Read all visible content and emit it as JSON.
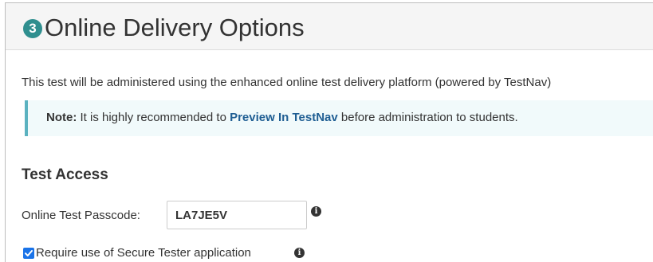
{
  "section": {
    "step_number": "3",
    "title": "Online Delivery Options"
  },
  "intro": {
    "text": "This test will be administered using the enhanced online test delivery platform (powered by TestNav)"
  },
  "note": {
    "label": "Note:",
    "text_before": " It is highly recommended to ",
    "link_text": "Preview In TestNav",
    "text_after": " before administration to students."
  },
  "test_access": {
    "heading": "Test Access",
    "passcode_label": "Online Test Passcode:",
    "passcode_value": "LA7JE5V",
    "secure_tester_label": "Require use of Secure Tester application",
    "secure_tester_checked": true
  },
  "colors": {
    "step_badge": "#2f8f8f",
    "note_border": "#5bb2c0",
    "note_background": "#f1fafb",
    "link": "#1f5e93",
    "checkbox": "#1a73e8"
  },
  "icons": {
    "info": "info-circle-icon",
    "check": "checkmark-icon"
  }
}
